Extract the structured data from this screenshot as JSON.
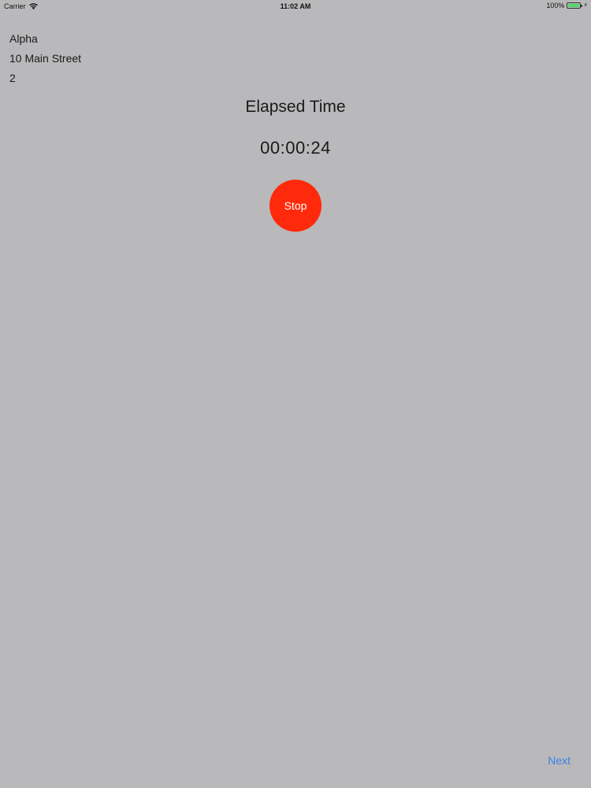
{
  "status_bar": {
    "carrier": "Carrier",
    "time": "11:02 AM",
    "battery_percent": "100%",
    "battery_level": 1.0,
    "battery_color": "#4cd964",
    "icons": [
      "wifi-icon",
      "battery-icon",
      "charging-icon"
    ]
  },
  "info": {
    "name": "Alpha",
    "address": "10 Main Street",
    "number": "2"
  },
  "timer": {
    "title": "Elapsed Time",
    "value": "00:00:24"
  },
  "actions": {
    "stop_label": "Stop",
    "stop_color": "#ff2a0b",
    "next_label": "Next",
    "next_color": "#3a82e8"
  },
  "background_color": "#b9b8ba"
}
